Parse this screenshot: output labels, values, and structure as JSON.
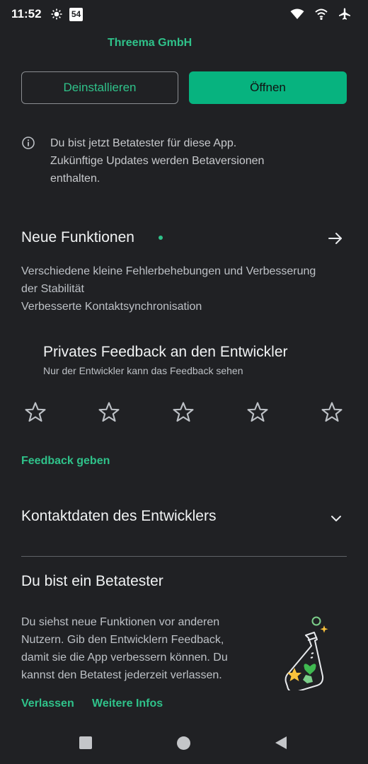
{
  "status_bar": {
    "time": "11:52",
    "badge": "54"
  },
  "app": {
    "developer": "Threema GmbH"
  },
  "actions": {
    "uninstall_label": "Deinstallieren",
    "open_label": "Öffnen"
  },
  "beta_notice": {
    "lines": [
      "Du bist jetzt Betatester für diese App.",
      "Zukünftige Updates werden Betaversionen",
      "enthalten."
    ]
  },
  "whats_new": {
    "title": "Neue Funktionen",
    "lines": [
      "Verschiedene kleine Fehlerbehebungen und Verbesserung",
      "der Stabilität",
      "Verbesserte Kontaktsynchronisation"
    ]
  },
  "private_feedback": {
    "title": "Privates Feedback an den Entwickler",
    "subtitle": "Nur der Entwickler kann das Feedback sehen",
    "star_count": 5,
    "link_label": "Feedback geben"
  },
  "developer_contact": {
    "title": "Kontaktdaten des Entwicklers"
  },
  "beta_section": {
    "title": "Du bist ein Betatester",
    "lines": [
      "Du siehst neue Funktionen vor anderen",
      "Nutzern. Gib den Entwicklern Feedback,",
      "damit sie die App verbessern können. Du",
      "kannst den Betatest jederzeit verlassen."
    ],
    "leave_label": "Verlassen",
    "more_info_label": "Weitere Infos"
  },
  "colors": {
    "background": "#202124",
    "accent": "#2fc28a",
    "button_fill": "#07b37f"
  },
  "icons": [
    "brightness-icon",
    "wifi-icon",
    "hotspot-icon",
    "airplane-icon",
    "info-icon",
    "arrow-right-icon",
    "star-icon",
    "chevron-down-icon",
    "beta-flask-icon"
  ]
}
